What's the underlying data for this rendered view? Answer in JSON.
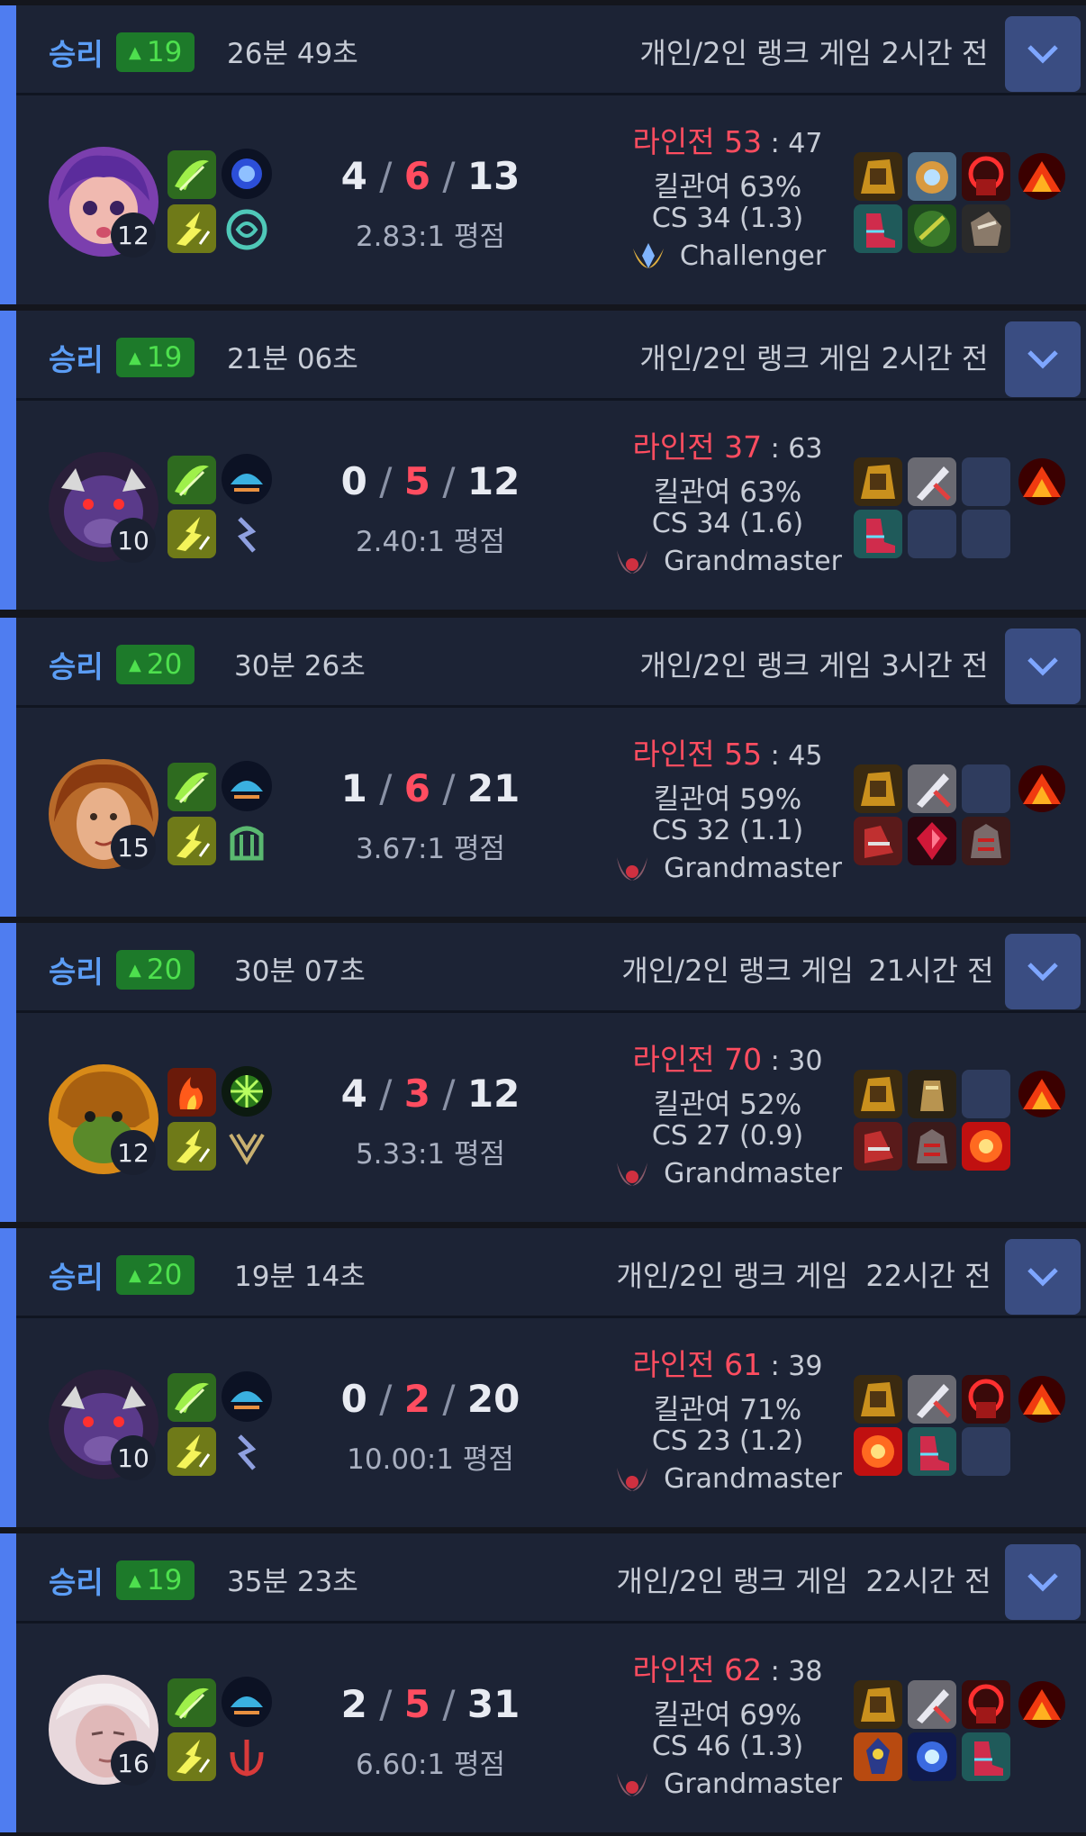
{
  "matches": [
    {
      "result": "승리",
      "lp": "19",
      "duration": "26분 49초",
      "queue": "개인/2인 랭크 게임",
      "ago": "2시간 전",
      "level": "12",
      "k": "4",
      "d": "6",
      "a": "13",
      "ratio": "2.83:1 평점",
      "lane_label": "라인전 53",
      "lane_opp": "47",
      "kp": "킬관여 63%",
      "cs": "CS 34 (1.3)",
      "tier": "Challenger"
    },
    {
      "result": "승리",
      "lp": "19",
      "duration": "21분 06초",
      "queue": "개인/2인 랭크 게임",
      "ago": "2시간 전",
      "level": "10",
      "k": "0",
      "d": "5",
      "a": "12",
      "ratio": "2.40:1 평점",
      "lane_label": "라인전 37",
      "lane_opp": "63",
      "kp": "킬관여 63%",
      "cs": "CS 34 (1.6)",
      "tier": "Grandmaster"
    },
    {
      "result": "승리",
      "lp": "20",
      "duration": "30분 26초",
      "queue": "개인/2인 랭크 게임",
      "ago": "3시간 전",
      "level": "15",
      "k": "1",
      "d": "6",
      "a": "21",
      "ratio": "3.67:1 평점",
      "lane_label": "라인전 55",
      "lane_opp": "45",
      "kp": "킬관여 59%",
      "cs": "CS 32 (1.1)",
      "tier": "Grandmaster"
    },
    {
      "result": "승리",
      "lp": "20",
      "duration": "30분 07초",
      "queue": "개인/2인 랭크 게임",
      "ago": "21시간 전",
      "level": "12",
      "k": "4",
      "d": "3",
      "a": "12",
      "ratio": "5.33:1 평점",
      "lane_label": "라인전 70",
      "lane_opp": "30",
      "kp": "킬관여 52%",
      "cs": "CS 27 (0.9)",
      "tier": "Grandmaster"
    },
    {
      "result": "승리",
      "lp": "20",
      "duration": "19분 14초",
      "queue": "개인/2인 랭크 게임",
      "ago": "22시간 전",
      "level": "10",
      "k": "0",
      "d": "2",
      "a": "20",
      "ratio": "10.00:1 평점",
      "lane_label": "라인전 61",
      "lane_opp": "39",
      "kp": "킬관여 71%",
      "cs": "CS 23 (1.2)",
      "tier": "Grandmaster"
    },
    {
      "result": "승리",
      "lp": "19",
      "duration": "35분 23초",
      "queue": "개인/2인 랭크 게임",
      "ago": "22시간 전",
      "level": "16",
      "k": "2",
      "d": "5",
      "a": "31",
      "ratio": "6.60:1 평점",
      "lane_label": "라인전 62",
      "lane_opp": "38",
      "kp": "킬관여 69%",
      "cs": "CS 46 (1.3)",
      "tier": "Grandmaster"
    }
  ],
  "colors": {
    "win_accent": "#4f7df0",
    "lp_bg": "#1d7a2a",
    "lp_text": "#4ee04e",
    "death": "#ff4d60",
    "card_bg": "#1c2335"
  },
  "icons": {
    "expand": "chevron-down-icon",
    "lp": "triangle-up-icon",
    "tier": "rank-emblem-icon"
  }
}
